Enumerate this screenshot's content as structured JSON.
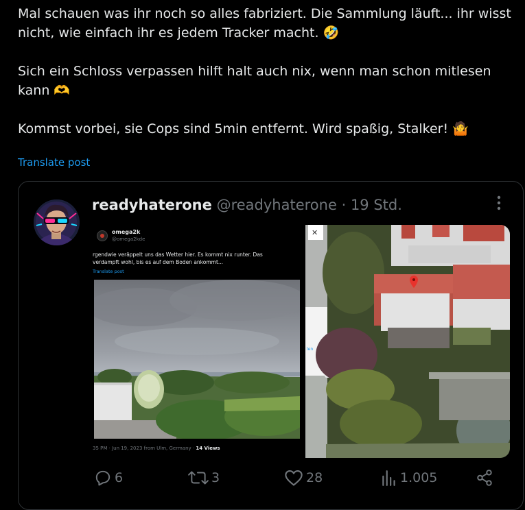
{
  "post": {
    "paragraphs": [
      "Mal schauen was ihr noch so alles fabriziert. Die Sammlung läuft... ihr wisst nicht, wie einfach ihr es jedem Tracker macht. 🤣",
      "Sich ein Schloss verpassen hilft halt auch nix, wenn man schon mitlesen kann 🫶",
      "Kommst vorbei, sie Cops sind 5min entfernt. Wird spaßig, Stalker! 🤷"
    ],
    "translate_label": "Translate post"
  },
  "quote": {
    "name": "readyhaterone",
    "handle": "@readyhaterone",
    "separator": "·",
    "time": "19 Std.",
    "more_icon": "more-dots-icon",
    "screenshot": {
      "name": "omega2k",
      "handle": "@omega2kde",
      "text": "rgendwie veräppelt uns das Wetter hier. Es kommt nix runter. Das verdampft wohl, bis es auf dem Boden ankommt...",
      "translate": "Translate post",
      "meta": "35 PM · Jun 19, 2023 from Ulm, Germany · ",
      "views": "14 Views",
      "close_glyph": "✕",
      "side_label": "len"
    }
  },
  "stats": {
    "replies": "6",
    "reposts": "3",
    "likes": "28",
    "views": "1.005"
  },
  "colors": {
    "accent": "#1d9bf0",
    "muted": "#71767b",
    "border": "#2f3336",
    "map_pin": "#e8322c"
  }
}
